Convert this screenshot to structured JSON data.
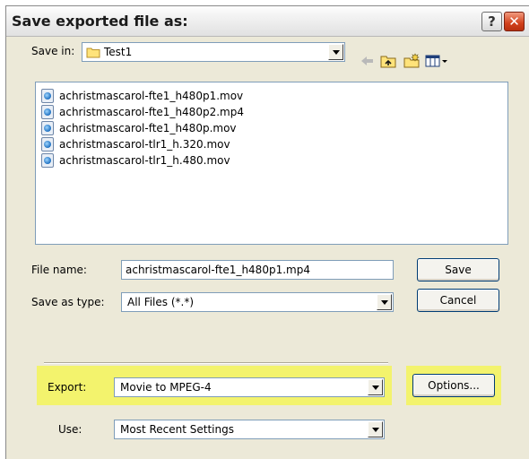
{
  "dialog": {
    "title": "Save exported file as:",
    "help_label": "?",
    "close_label": "✕"
  },
  "save_in": {
    "label": "Save in:",
    "value": "Test1"
  },
  "toolbar": {
    "icons": [
      "back-arrow-icon",
      "up-folder-icon",
      "new-folder-icon",
      "view-menu-icon"
    ]
  },
  "files": [
    "achristmascarol-fte1_h480p1.mov",
    "achristmascarol-fte1_h480p2.mp4",
    "achristmascarol-fte1_h480p.mov",
    "achristmascarol-tlr1_h.320.mov",
    "achristmascarol-tlr1_h.480.mov"
  ],
  "file_name": {
    "label": "File name:",
    "value": "achristmascarol-fte1_h480p1.mp4"
  },
  "save_as_type": {
    "label": "Save as type:",
    "value": "All Files (*.*)"
  },
  "buttons": {
    "save": "Save",
    "cancel": "Cancel",
    "options": "Options..."
  },
  "export": {
    "label": "Export:",
    "value": "Movie to MPEG-4"
  },
  "use": {
    "label": "Use:",
    "value": "Most Recent Settings"
  },
  "colors": {
    "highlight": "#f5f55a",
    "dialog_bg": "#ece9d8",
    "close_button": "#d2411c"
  }
}
